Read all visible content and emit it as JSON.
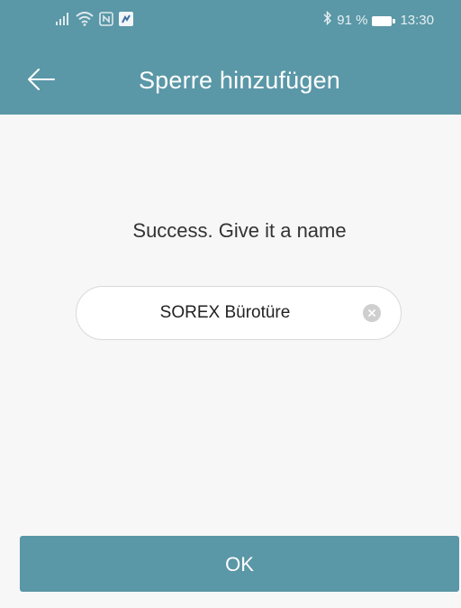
{
  "status_bar": {
    "battery_percent": "91 %",
    "time": "13:30",
    "icons": [
      "signal-icon",
      "wifi-icon",
      "nfc-icon",
      "notification-icon",
      "bluetooth-icon",
      "battery-icon"
    ]
  },
  "app_bar": {
    "back_icon": "arrow-left-icon",
    "title": "Sperre hinzufügen"
  },
  "main": {
    "prompt": "Success. Give it a name",
    "name_field": {
      "value": "SOREX Bürotüre",
      "clear_icon": "clear-icon"
    },
    "ok_label": "OK"
  },
  "colors": {
    "accent": "#5a97a7",
    "background": "#f7f7f7",
    "field_border": "#d9d9d9",
    "clear_icon": "#cfcfcf"
  }
}
